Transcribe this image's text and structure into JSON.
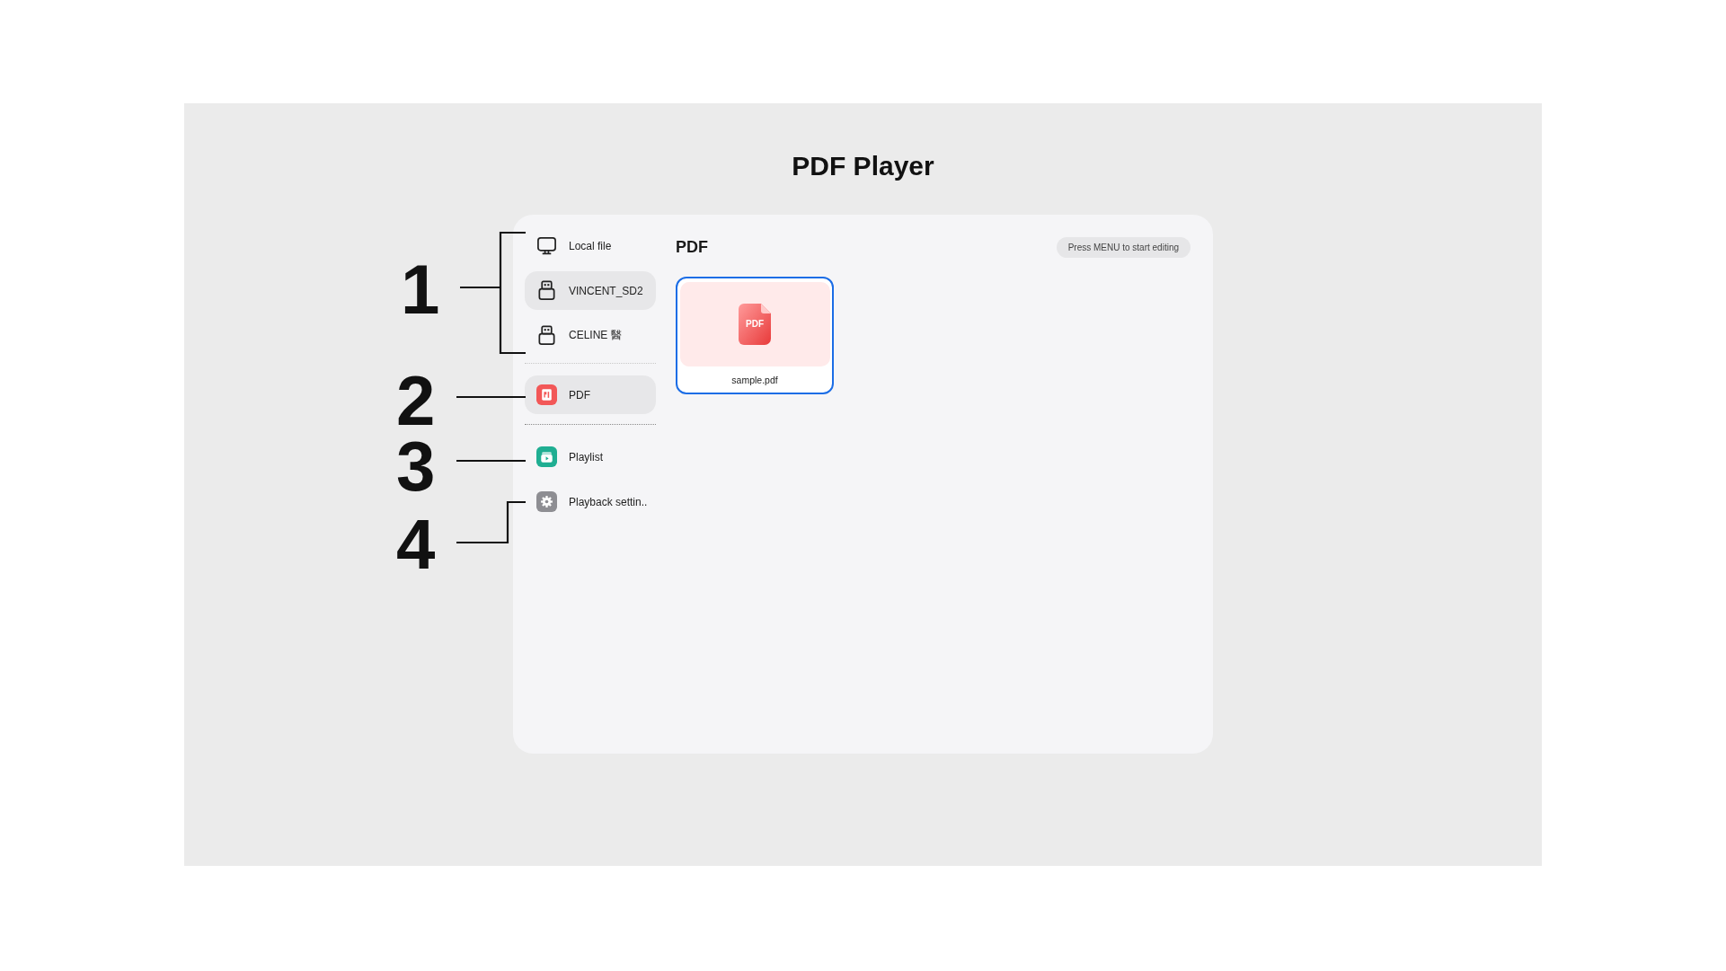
{
  "title": "PDF Player",
  "callouts": [
    {
      "number": "1",
      "kind": "bracket"
    },
    {
      "number": "2",
      "kind": "line"
    },
    {
      "number": "3",
      "kind": "line"
    },
    {
      "number": "4",
      "kind": "elbow"
    }
  ],
  "sidebar": {
    "sources": [
      {
        "label": "Local file",
        "kind": "local",
        "selected": false
      },
      {
        "label": "VINCENT_SD2",
        "kind": "usb",
        "selected": true
      },
      {
        "label": "CELINE 醫",
        "kind": "usb",
        "selected": false
      }
    ],
    "categories": [
      {
        "label": "PDF",
        "kind": "pdf",
        "selected": true
      }
    ],
    "tools": [
      {
        "label": "Playlist",
        "kind": "playlist",
        "selected": false
      },
      {
        "label": "Playback settin..",
        "kind": "settings",
        "selected": false
      }
    ]
  },
  "content": {
    "heading": "PDF",
    "hint": "Press MENU to start editing",
    "files": [
      {
        "name": "sample.pdf",
        "type_label": "PDF",
        "selected": true
      }
    ]
  }
}
